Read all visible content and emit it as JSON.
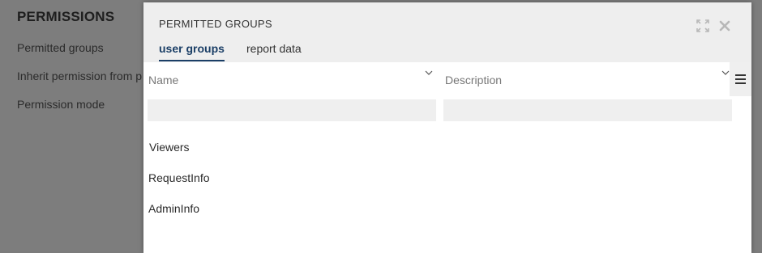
{
  "background": {
    "title": "PERMISSIONS",
    "labels": [
      "Permitted groups",
      "Inherit permission from p",
      "Permission mode"
    ]
  },
  "dialog": {
    "title": "PERMITTED GROUPS",
    "expand_icon": "expand-icon",
    "close_icon": "close-icon",
    "tabs": [
      {
        "label": "user groups",
        "active": true
      },
      {
        "label": "report data",
        "active": false
      }
    ]
  },
  "grid": {
    "columns": [
      {
        "label": "Name"
      },
      {
        "label": "Description"
      }
    ],
    "filters": {
      "name": "",
      "description": ""
    },
    "rows": [
      {
        "name": "Viewers",
        "description": ""
      },
      {
        "name": "RequestInfo",
        "description": ""
      },
      {
        "name": "AdminInfo",
        "description": ""
      }
    ]
  },
  "colors": {
    "accent": "#1a3e66",
    "header_bg": "#eeeeee",
    "filter_bg": "#efefef"
  }
}
